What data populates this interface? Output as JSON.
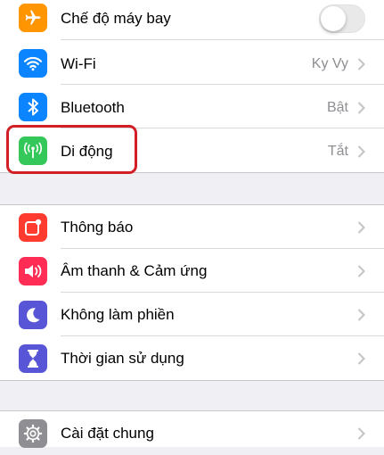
{
  "colors": {
    "airplane": "#ff9500",
    "wifi": "#0a84ff",
    "bluetooth": "#0a84ff",
    "cellular": "#34c759",
    "notifications": "#ff3b30",
    "sounds": "#ff2d55",
    "dnd": "#5856d6",
    "screentime": "#5856d6",
    "general": "#8e8e93",
    "highlight": "#d21f26"
  },
  "group1": {
    "airplane": {
      "label": "Chế độ máy bay",
      "icon": "airplane-icon",
      "toggle_on": false
    },
    "wifi": {
      "label": "Wi-Fi",
      "value": "Ky Vy",
      "icon": "wifi-icon"
    },
    "bluetooth": {
      "label": "Bluetooth",
      "value": "Bật",
      "icon": "bluetooth-icon"
    },
    "cellular": {
      "label": "Di động",
      "value": "Tắt",
      "icon": "antenna-icon"
    }
  },
  "group2": {
    "notifications": {
      "label": "Thông báo",
      "icon": "notification-icon"
    },
    "sounds": {
      "label": "Âm thanh & Cảm ứng",
      "icon": "speaker-icon"
    },
    "dnd": {
      "label": "Không làm phiền",
      "icon": "moon-icon"
    },
    "screentime": {
      "label": "Thời gian sử dụng",
      "icon": "hourglass-icon"
    }
  },
  "group3": {
    "general": {
      "label": "Cài đặt chung",
      "icon": "gear-icon"
    }
  }
}
